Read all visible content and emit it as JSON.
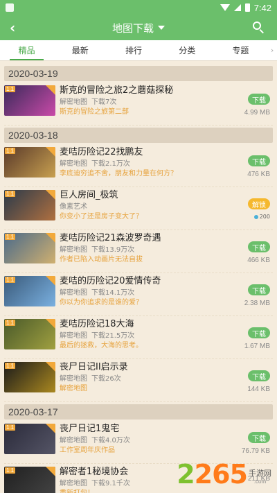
{
  "status": {
    "time": "7:42"
  },
  "header": {
    "title": "地图下载"
  },
  "tabs": [
    "精品",
    "最新",
    "排行",
    "分类",
    "专题"
  ],
  "groups": [
    {
      "date": "2020-03-19",
      "items": [
        {
          "name": "斯克的冒险之旅2之蘑菇探秘",
          "category": "解密地图",
          "downloads": "下载7次",
          "desc": "斯克的冒险之旅第二部",
          "action": "下载",
          "size": "4.99 MB"
        }
      ]
    },
    {
      "date": "2020-03-18",
      "items": [
        {
          "name": "麦咭历险记22找鹏友",
          "category": "解密地图",
          "downloads": "下载2.1万次",
          "desc": "李底迪穷追不舍，朋友和力量在何方？",
          "action": "下载",
          "size": "476 KB"
        },
        {
          "name": "巨人房间_极筑",
          "category": "像素艺术",
          "downloads": "",
          "desc": "你变小了还是房子变大了？",
          "action": "解锁",
          "coin": "200"
        },
        {
          "name": "麦咭历险记21森波罗奇遇",
          "category": "解密地图",
          "downloads": "下载13.9万次",
          "desc": "作者已陷入动画片无法自拔",
          "action": "下载",
          "size": "466 KB"
        },
        {
          "name": "麦咭的历险记20爱情传奇",
          "category": "解密地图",
          "downloads": "下载14.1万次",
          "desc": "你以为你追求的是谁的爱？",
          "action": "下载",
          "size": "2.38 MB"
        },
        {
          "name": "麦咭历险记18大海",
          "category": "解密地图",
          "downloads": "下载21.5万次",
          "desc": "最后的拯救，大海的思考。",
          "action": "下载",
          "size": "1.67 MB"
        },
        {
          "name": "丧尸日记II启示录",
          "category": "解密地图",
          "downloads": "下载26次",
          "desc": "解密地图",
          "action": "下载",
          "size": "144 KB"
        }
      ]
    },
    {
      "date": "2020-03-17",
      "items": [
        {
          "name": "丧尸日记1鬼宅",
          "category": "解密地图",
          "downloads": "下载4.0万次",
          "desc": "工作室周年庆作品",
          "action": "下载",
          "size": "76.79 KB"
        },
        {
          "name": "解密者1秘境协会",
          "category": "解密地图",
          "downloads": "下载9.1千次",
          "desc": "重新打包！",
          "action": "",
          "size": "211 KB"
        }
      ]
    }
  ],
  "watermark": {
    "num": "2265",
    "suffix": ".com",
    "cn": "手游网"
  },
  "colors": {
    "accent": "#6bbf6b",
    "orange": "#e6a23c",
    "bg": "#f5ecdd"
  }
}
